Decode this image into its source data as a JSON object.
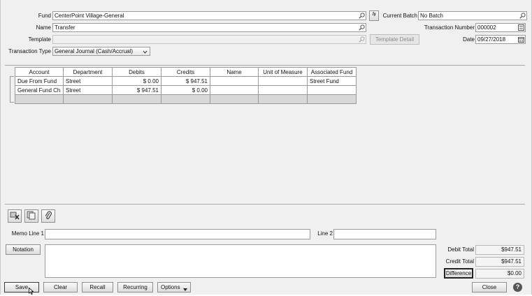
{
  "header": {
    "fund_label": "Fund",
    "fund_value": "CenterPoint Village-General",
    "name_label": "Name",
    "name_value": "Transfer",
    "template_label": "Template",
    "template_value": "",
    "transaction_type_label": "Transaction Type",
    "transaction_type_value": "General Journal (Cash/Accrual)",
    "current_batch_label": "Current Batch",
    "current_batch_value": "No Batch",
    "transaction_number_label": "Transaction Number",
    "transaction_number_value": "000002",
    "date_label": "Date",
    "date_value": "09/27/2018",
    "template_detail_label": "Template Detail"
  },
  "grid": {
    "columns": [
      "Account",
      "Department",
      "Debits",
      "Credits",
      "Name",
      "Unit of Measure",
      "Associated Fund"
    ],
    "rows": [
      [
        "Due From Fund",
        "Street",
        "$ 0.00",
        "$ 947.51",
        "",
        "",
        "Street Fund"
      ],
      [
        "General Fund Ch",
        "Street",
        "$ 947.51",
        "$ 0.00",
        "",
        "",
        ""
      ]
    ]
  },
  "memo": {
    "line1_label": "Memo Line 1",
    "line1_value": "",
    "line2_label": "Line 2",
    "line2_value": ""
  },
  "notation": {
    "button_label": "Notation",
    "text": ""
  },
  "totals": {
    "debit_label": "Debit Total",
    "debit_value": "$947.51",
    "credit_label": "Credit Total",
    "credit_value": "$947.51",
    "difference_label": "Difference",
    "difference_value": "$0.00"
  },
  "footer": {
    "save_label": "Save",
    "clear_label": "Clear",
    "recall_label": "Recall",
    "recurring_label": "Recurring",
    "options_label": "Options",
    "close_label": "Close"
  },
  "icons": {
    "lookup": "magnifier-icon",
    "calendar": "calendar-icon",
    "spin": "spin-icon",
    "delete_row": "delete-row-icon",
    "copy": "copy-icon",
    "attach": "paperclip-icon",
    "help": "help-icon"
  }
}
